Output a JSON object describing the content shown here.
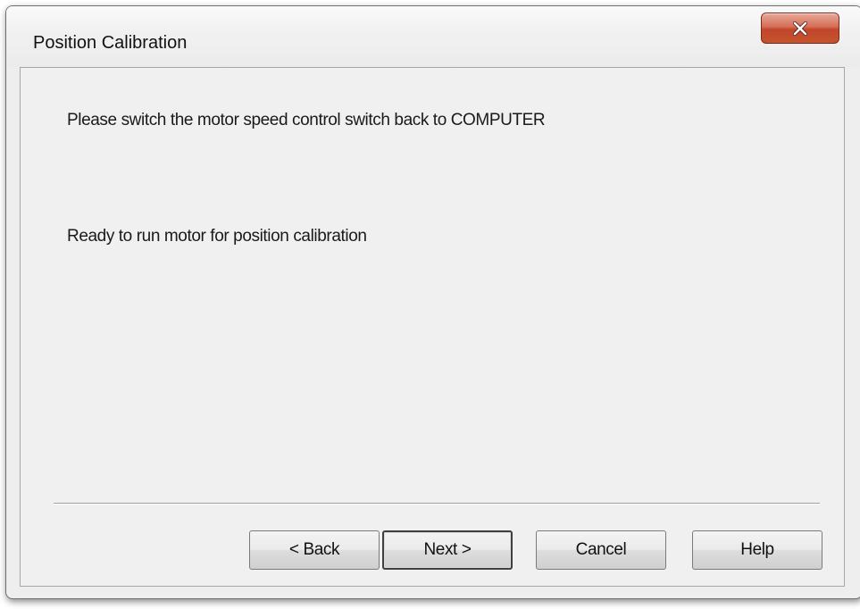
{
  "window": {
    "title": "Position Calibration",
    "close_icon": "close-x-icon"
  },
  "content": {
    "message_1": "Please switch the motor speed control switch back to COMPUTER",
    "message_2": "Ready to run motor for position calibration"
  },
  "buttons": {
    "back": "< Back",
    "next": "Next >",
    "cancel": "Cancel",
    "help": "Help",
    "default": "next"
  },
  "colors": {
    "close_button": "#c7503a",
    "dialog_background": "#f0f0f0"
  }
}
